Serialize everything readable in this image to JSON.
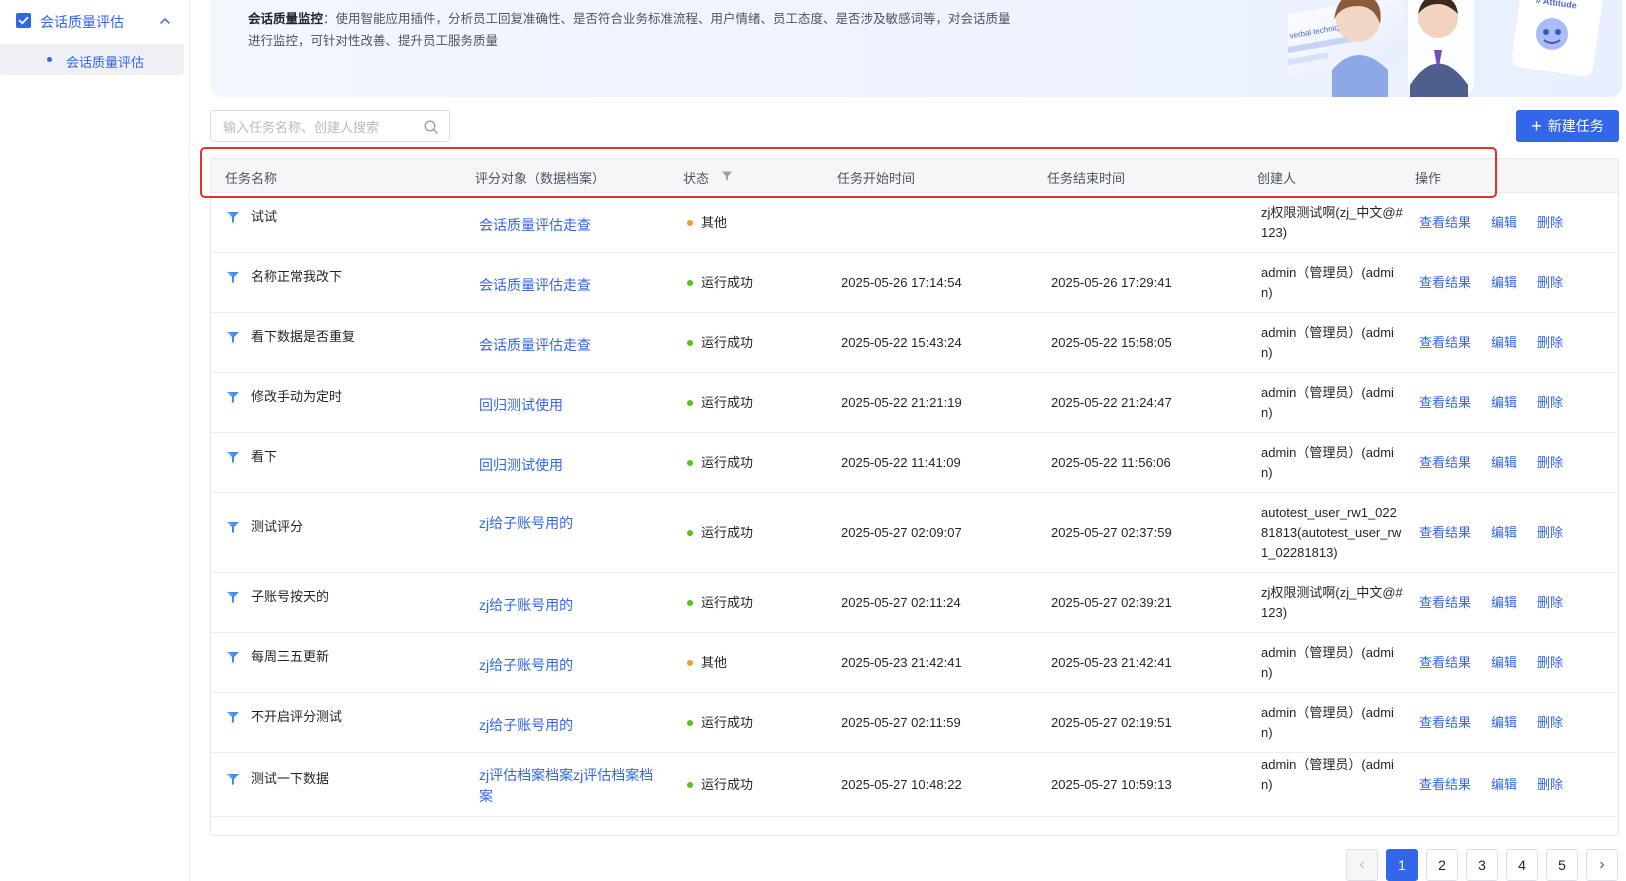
{
  "sidebar": {
    "group_label": "会话质量评估",
    "items": [
      {
        "label": "会话质量评估"
      }
    ]
  },
  "banner": {
    "title": "会话质量监控",
    "description": "：使用智能应用插件，分析员工回复准确性、是否符合业务标准流程、用户情绪、员工态度、是否涉及敏感词等，对会话质量进行监控，可针对性改善、提升员工服务质量",
    "art_text_1": "# Best verbal technique",
    "art_text_2": "# Attitude"
  },
  "search": {
    "placeholder": "输入任务名称、创建人搜索",
    "value": ""
  },
  "new_task_label": "新建任务",
  "table": {
    "headers": {
      "name": "任务名称",
      "target": "评分对象（数据档案）",
      "status": "状态",
      "start": "任务开始时间",
      "end": "任务结束时间",
      "creator": "创建人",
      "ops": "操作"
    },
    "ops_labels": {
      "view": "查看结果",
      "edit": "编辑",
      "delete": "删除"
    },
    "status_colors": {
      "运行成功": "#52c41a",
      "其他": "#f0a020"
    },
    "rows": [
      {
        "name": "试试",
        "target": "会话质量评估走查",
        "status": "其他",
        "start": "",
        "end": "",
        "creator": "zj权限测试啊(zj_中文@#123)"
      },
      {
        "name": "名称正常我改下",
        "target": "会话质量评估走查",
        "status": "运行成功",
        "start": "2025-05-26 17:14:54",
        "end": "2025-05-26 17:29:41",
        "creator": "admin（管理员）(admin)"
      },
      {
        "name": "看下数据是否重复",
        "target": "会话质量评估走查",
        "status": "运行成功",
        "start": "2025-05-22 15:43:24",
        "end": "2025-05-22 15:58:05",
        "creator": "admin（管理员）(admin)"
      },
      {
        "name": "修改手动为定时",
        "target": "回归测试使用",
        "status": "运行成功",
        "start": "2025-05-22 21:21:19",
        "end": "2025-05-22 21:24:47",
        "creator": "admin（管理员）(admin)"
      },
      {
        "name": "看下",
        "target": "回归测试使用",
        "status": "运行成功",
        "start": "2025-05-22 11:41:09",
        "end": "2025-05-22 11:56:06",
        "creator": "admin（管理员）(admin)"
      },
      {
        "name": "测试评分",
        "target": "zj给子账号用的",
        "status": "运行成功",
        "start": "2025-05-27 02:09:07",
        "end": "2025-05-27 02:37:59",
        "creator": "autotest_user_rw1_02281813(autotest_user_rw1_02281813)"
      },
      {
        "name": "子账号按天的",
        "target": "zj给子账号用的",
        "status": "运行成功",
        "start": "2025-05-27 02:11:24",
        "end": "2025-05-27 02:39:21",
        "creator": "zj权限测试啊(zj_中文@#123)"
      },
      {
        "name": "每周三五更新",
        "target": "zj给子账号用的",
        "status": "其他",
        "start": "2025-05-23 21:42:41",
        "end": "2025-05-23 21:42:41",
        "creator": "admin（管理员）(admin)"
      },
      {
        "name": "不开启评分测试",
        "target": "zj给子账号用的",
        "status": "运行成功",
        "start": "2025-05-27 02:11:59",
        "end": "2025-05-27 02:19:51",
        "creator": "admin（管理员）(admin)"
      },
      {
        "name": "测试一下数据",
        "target": "zj评估档案档案zj评估档案档案",
        "status": "运行成功",
        "start": "2025-05-27 10:48:22",
        "end": "2025-05-27 10:59:13",
        "creator": "admin（管理员）(admin)"
      }
    ]
  },
  "pagination": {
    "pages": [
      "1",
      "2",
      "3",
      "4",
      "5"
    ],
    "current": "1"
  }
}
